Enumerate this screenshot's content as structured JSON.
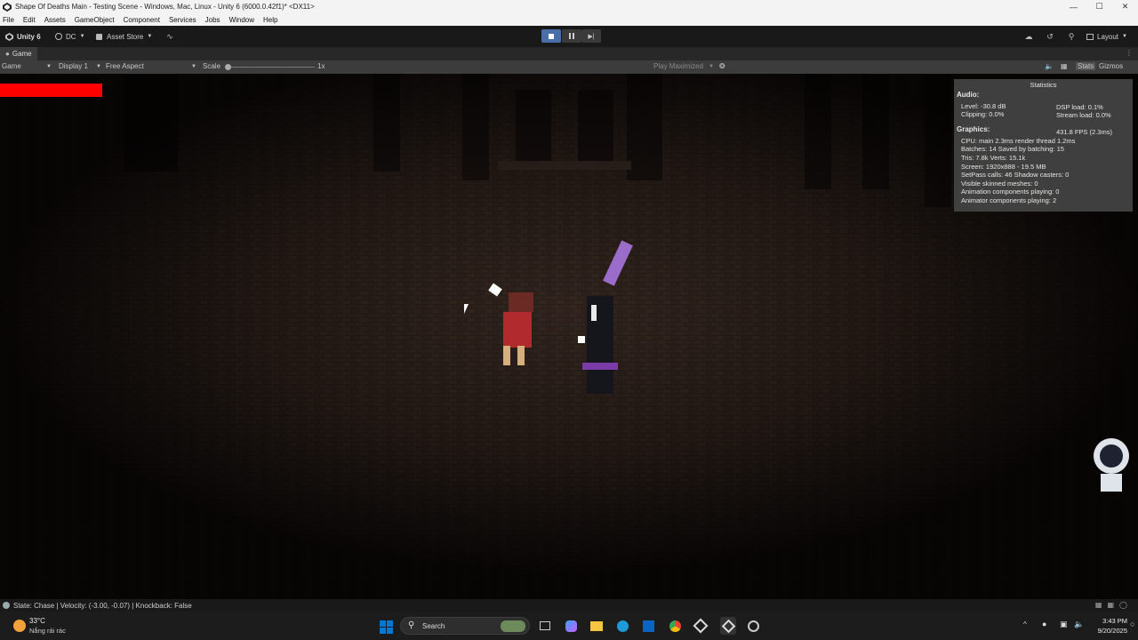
{
  "window": {
    "title": "Shape Of Deaths Main - Testing Scene - Windows, Mac, Linux - Unity 6 (6000.0.42f1)* <DX11>"
  },
  "menu": [
    "File",
    "Edit",
    "Assets",
    "GameObject",
    "Component",
    "Services",
    "Jobs",
    "Window",
    "Help"
  ],
  "toolbar": {
    "unity_label": "Unity 6",
    "account_label": "DC",
    "asset_store_label": "Asset Store",
    "layout_label": "Layout"
  },
  "game_tab": {
    "tab_label": "Game",
    "display": "Display 1",
    "aspect": "Free Aspect",
    "scale_label": "Scale",
    "scale_value": "1x",
    "play_maximized": "Play Maximized",
    "stats_label": "Stats",
    "gizmos_label": "Gizmos"
  },
  "stats": {
    "title": "Statistics",
    "audio_header": "Audio:",
    "level": "Level: -30.8 dB",
    "clipping": "Clipping: 0.0%",
    "dsp_load": "DSP load: 0.1%",
    "stream_load": "Stream load: 0.0%",
    "graphics_header": "Graphics:",
    "fps": "431.8 FPS (2.3ms)",
    "cpu": "CPU: main 2.3ms  render thread 1.2ms",
    "batches": "Batches: 14    Saved by batching: 15",
    "tris": "Tris: 7.8k   Verts: 15.1k",
    "screen": "Screen: 1920x888 - 19.5 MB",
    "setpass": "SetPass calls: 46    Shadow casters: 0",
    "skinned": "Visible skinned meshes: 0",
    "anim": "Animation components playing: 0",
    "animator": "Animator components playing: 2"
  },
  "hud": {
    "health_fraction": 0.09,
    "health_color": "#ff0000"
  },
  "status_bar": {
    "text": "State: Chase | Velocity: (-3.00, -0.07) | Knockback: False"
  },
  "taskbar": {
    "weather_temp": "33°C",
    "weather_desc": "Nắng rải rác",
    "search_label": "Search",
    "time": "3:43 PM",
    "date": "9/20/2025"
  },
  "colors": {
    "accent": "#4a6fa8",
    "editor_bg": "#191919",
    "windows_blue": "#0078d4"
  }
}
